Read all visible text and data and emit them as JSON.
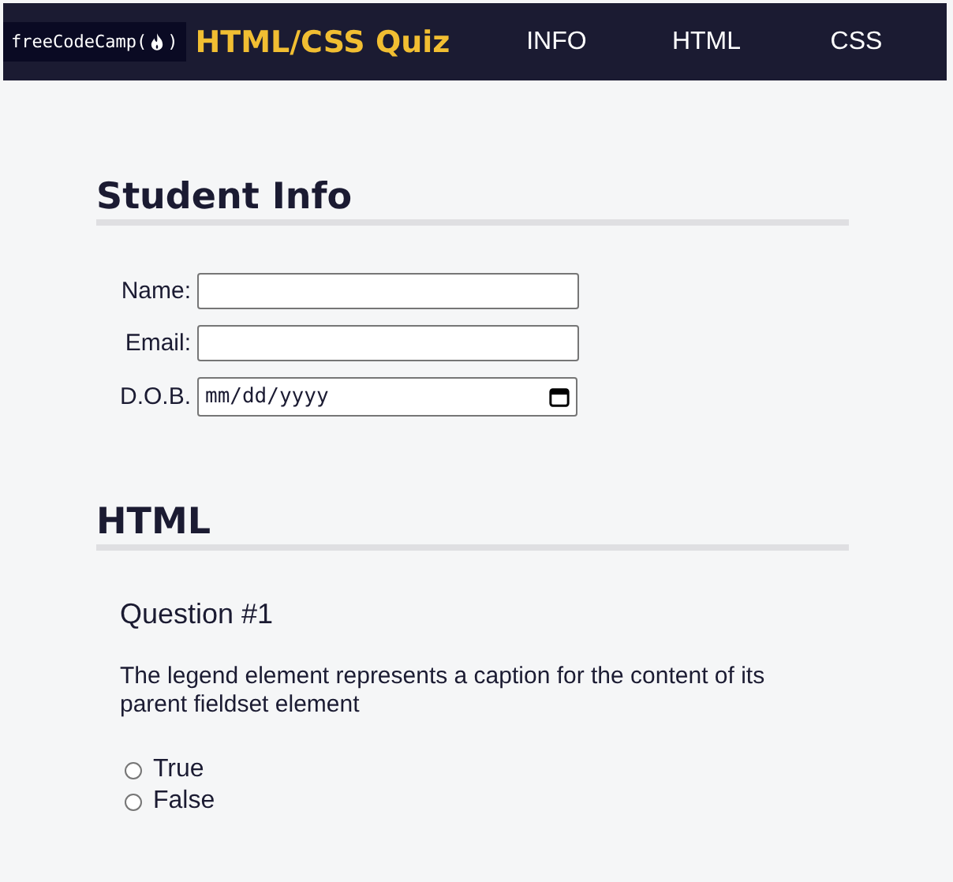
{
  "header": {
    "logo": {
      "prefix": "freeCodeCamp(",
      "suffix": ")"
    },
    "title": "HTML/CSS Quiz",
    "nav": [
      {
        "label": "INFO"
      },
      {
        "label": "HTML"
      },
      {
        "label": "CSS"
      }
    ]
  },
  "sections": [
    {
      "heading": "Student Info",
      "fields": [
        {
          "label": "Name:",
          "kind": "text"
        },
        {
          "label": "Email:",
          "kind": "text"
        },
        {
          "label": "D.O.B.",
          "kind": "date",
          "value": "mm/dd/yyyy"
        }
      ]
    },
    {
      "heading": "HTML",
      "questions": [
        {
          "title": "Question #1",
          "text": "The legend element represents a caption for the content of its parent fieldset element",
          "options": [
            {
              "label": "True",
              "selected": false
            },
            {
              "label": "False",
              "selected": false
            }
          ]
        }
      ]
    }
  ]
}
